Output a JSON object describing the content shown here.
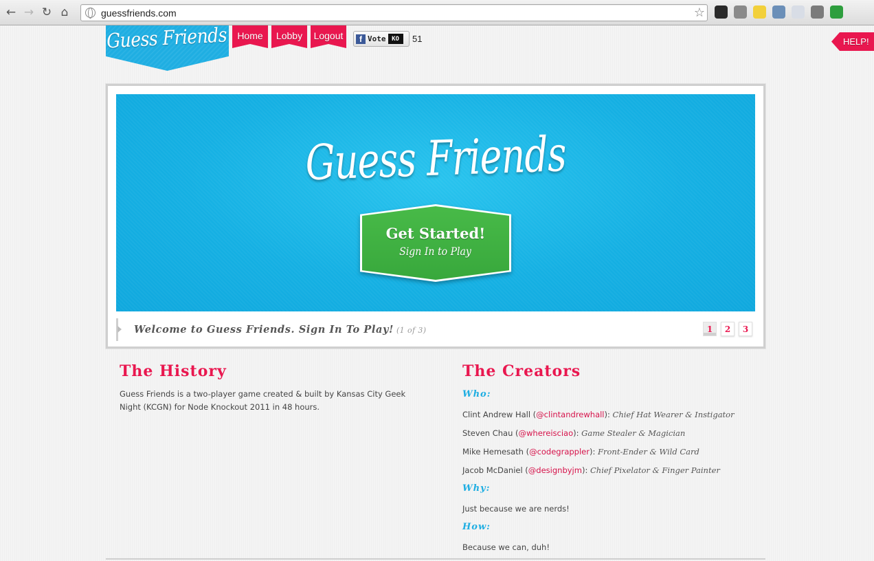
{
  "browser": {
    "url": "guessfriends.com",
    "extensions": [
      {
        "name": "octocat-icon",
        "color": "#2b2b2b"
      },
      {
        "name": "gear-icon",
        "color": "#8a8a8a"
      },
      {
        "name": "note-icon",
        "color": "#f2d03b"
      },
      {
        "name": "eyedropper-icon",
        "color": "#6b8fb8"
      },
      {
        "name": "mail-icon",
        "color": "#d8dde6"
      },
      {
        "name": "tag-icon",
        "color": "#7b7b7b"
      },
      {
        "name": "recycle-icon",
        "color": "#2e9e3e"
      }
    ]
  },
  "header": {
    "logo": "Guess Friends",
    "nav": {
      "home": "Home",
      "lobby": "Lobby",
      "logout": "Logout"
    },
    "vote": {
      "label": "Vote",
      "badge": "KO",
      "count": "51"
    },
    "help": "HELP!"
  },
  "slider": {
    "title": "Guess Friends",
    "cta_main": "Get Started!",
    "cta_sub": "Sign In to Play",
    "caption": "Welcome to Guess Friends. Sign In To Play!",
    "caption_count": "(1 of 3)",
    "pages": [
      "1",
      "2",
      "3"
    ],
    "active_page": "1"
  },
  "history": {
    "title": "The History",
    "text": "Guess Friends is a two-player game created & built by Kansas City Geek Night (KCGN) for Node Knockout 2011 in 48 hours."
  },
  "creators": {
    "title": "The Creators",
    "who_label": "Who:",
    "people": [
      {
        "name": "Clint Andrew Hall (",
        "handle": "@clintandrewhall",
        "sep": "): ",
        "role": "Chief Hat Wearer & Instigator"
      },
      {
        "name": "Steven Chau (",
        "handle": "@whereisciao",
        "sep": "): ",
        "role": "Game Stealer & Magician"
      },
      {
        "name": "Mike Hemesath (",
        "handle": "@codegrappler",
        "sep": "): ",
        "role": "Front-Ender & Wild Card"
      },
      {
        "name": "Jacob McDaniel (",
        "handle": "@designbyjm",
        "sep": "): ",
        "role": "Chief Pixelator & Finger Painter"
      }
    ],
    "why_label": "Why:",
    "why_text": "Just because we are nerds!",
    "how_label": "How:",
    "how_text": "Because we can, duh!"
  },
  "colors": {
    "brand_blue": "#1faee2",
    "brand_pink": "#e9174f",
    "cta_green": "#3fb142"
  }
}
